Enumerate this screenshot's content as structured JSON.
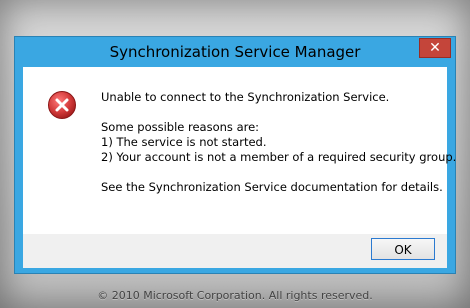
{
  "dialog": {
    "title": "Synchronization Service Manager",
    "close_label": "✕",
    "icon": "error-icon",
    "message": {
      "line1": "Unable to connect to the Synchronization Service.",
      "line2": "Some possible reasons are:",
      "line3": "1) The service is not started.",
      "line4": "2) Your account is not a member of a required security group.",
      "line5": "See the Synchronization Service documentation for details."
    },
    "ok_label": "OK"
  },
  "footer": {
    "copyright": "© 2010 Microsoft Corporation. All rights reserved."
  },
  "colors": {
    "accent": "#3aa7e2",
    "close": "#c4453a",
    "error": "#d23a3a"
  }
}
